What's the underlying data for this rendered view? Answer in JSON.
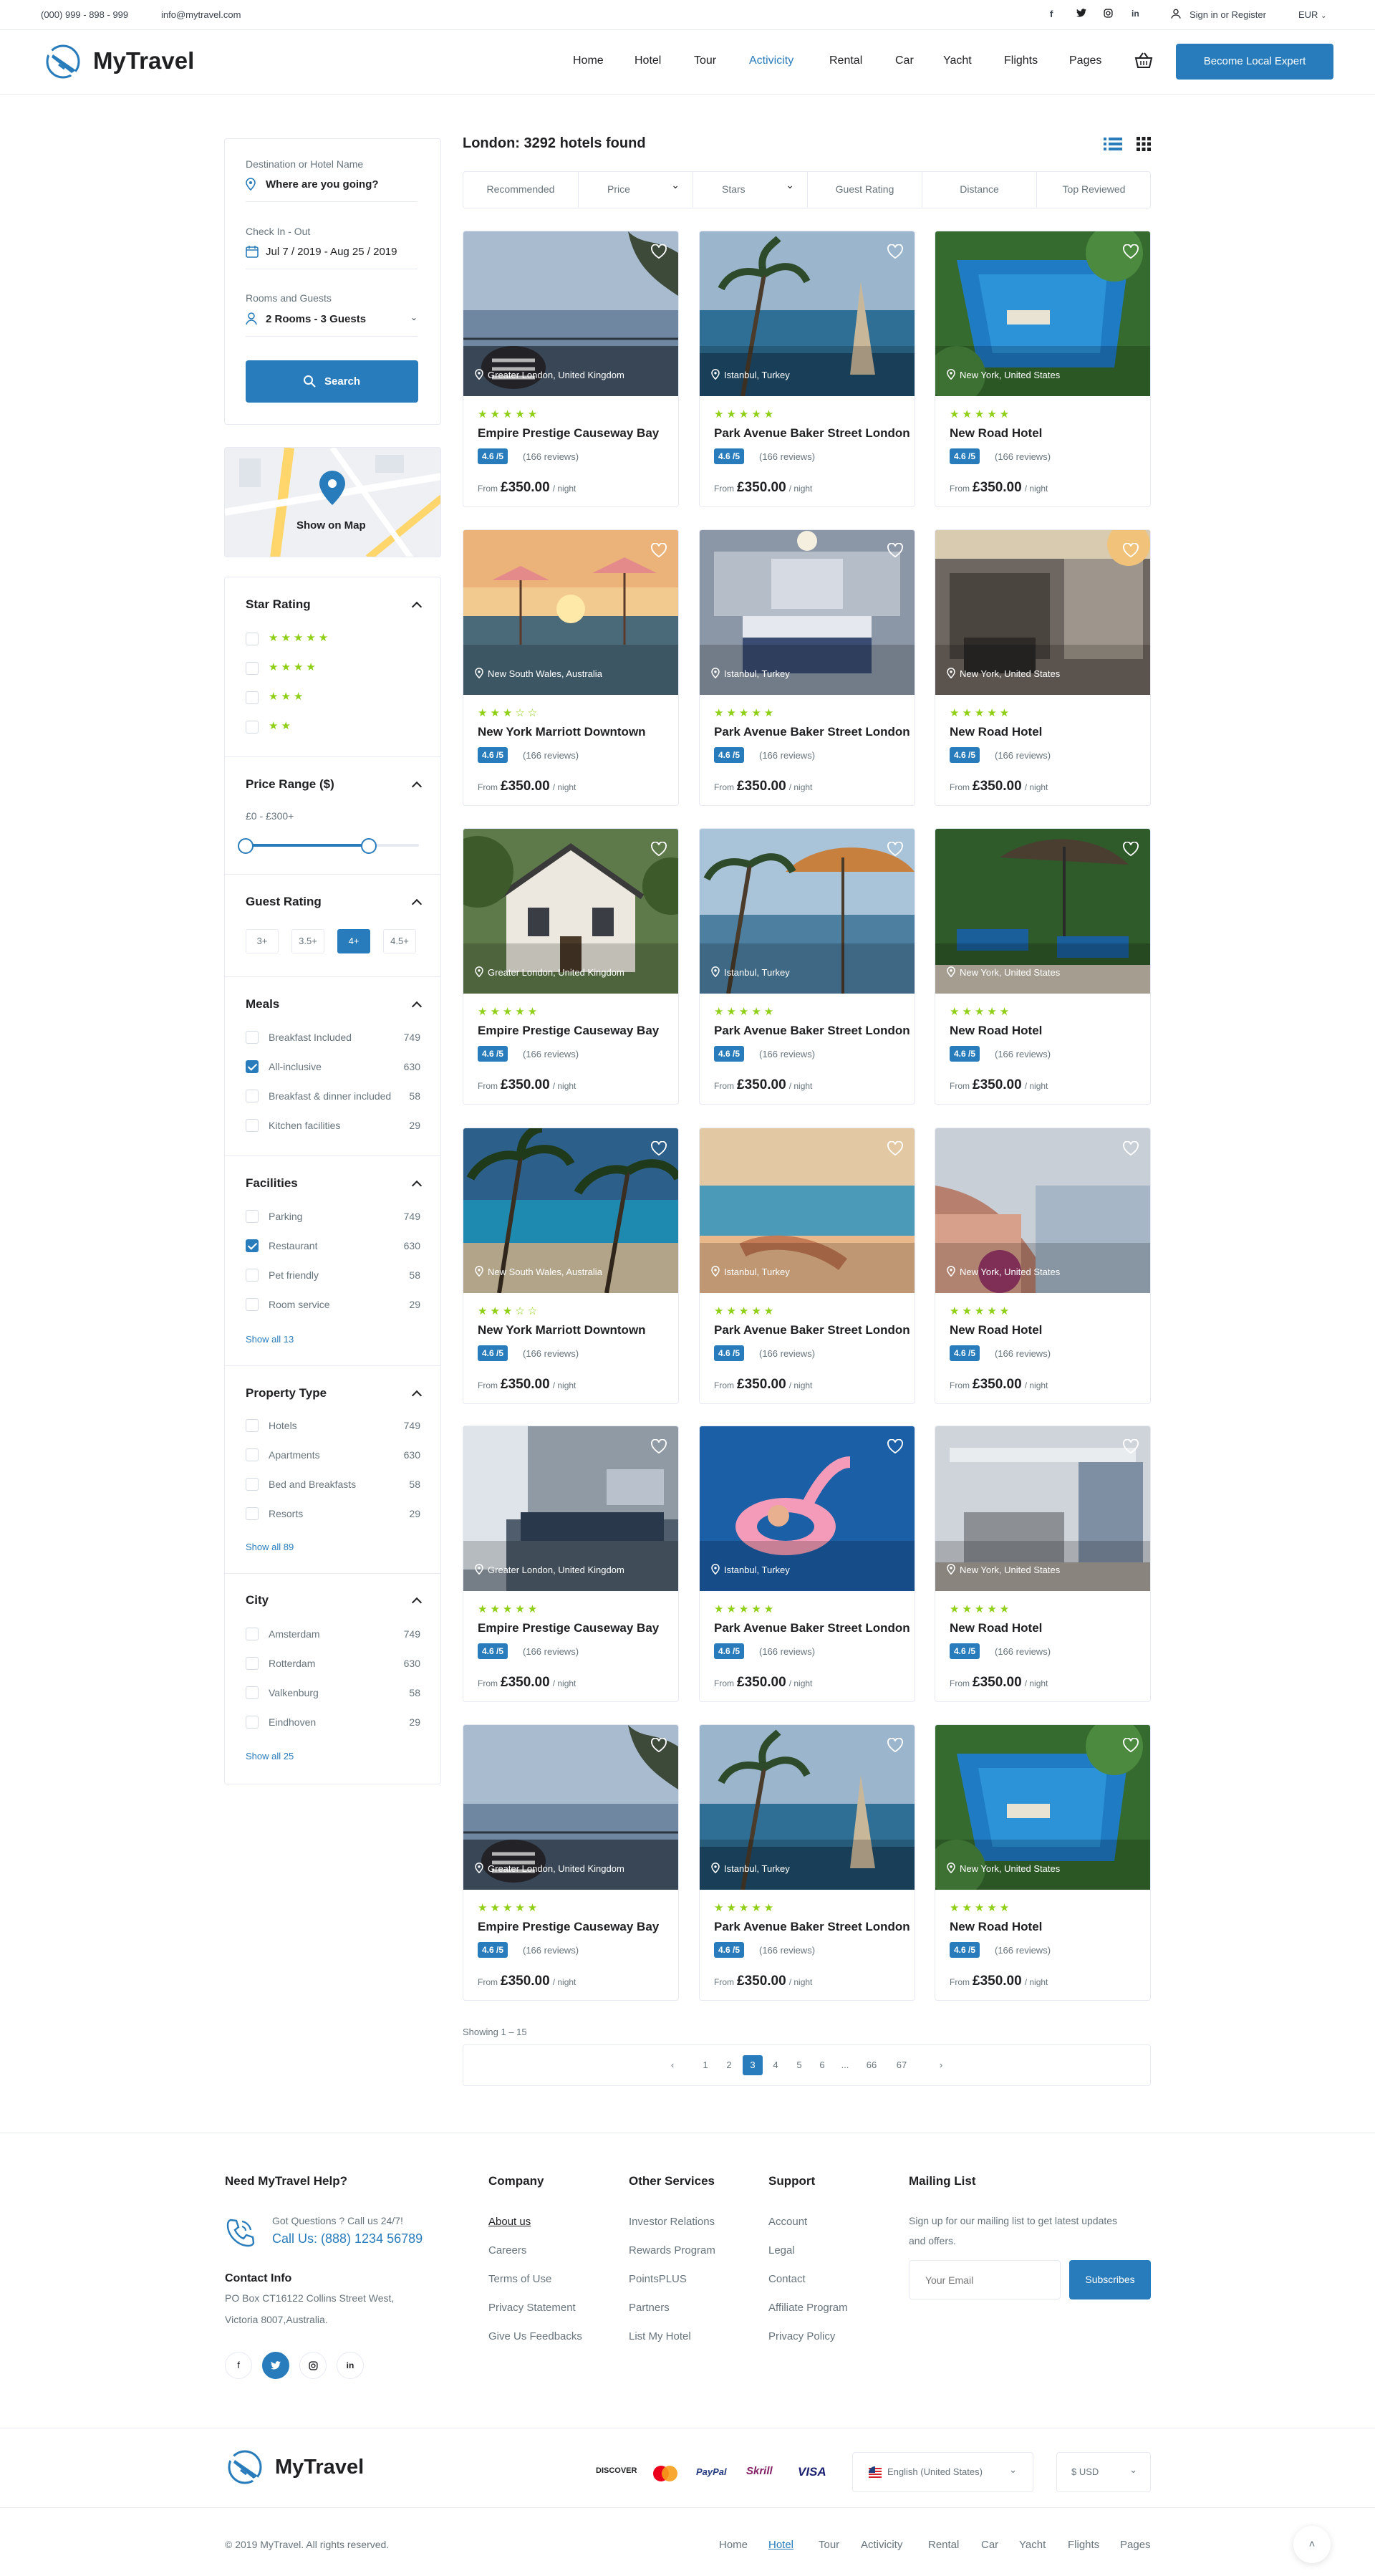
{
  "topbar": {
    "phone": "(000) 999 - 898 - 999",
    "email": "info@mytravel.com",
    "signin": "Sign in or Register",
    "currency": "EUR",
    "social": [
      "f",
      "t",
      "ig",
      "in"
    ]
  },
  "header": {
    "brand": "MyTravel",
    "nav": [
      "Home",
      "Hotel",
      "Tour",
      "Activicity",
      "Rental",
      "Car",
      "Yacht",
      "Flights",
      "Pages"
    ],
    "active_nav": "Activicity",
    "cta": "Become Local Expert"
  },
  "search": {
    "dest_label": "Destination or Hotel Name",
    "dest_value": "Where are you going?",
    "date_label": "Check In - Out",
    "date_value": "Jul 7 / 2019 - Aug 25 / 2019",
    "rooms_label": "Rooms and Guests",
    "rooms_value": "2 Rooms - 3 Guests",
    "button": "Search"
  },
  "map": {
    "label": "Show on Map"
  },
  "filters": {
    "star_title": "Star Rating",
    "star_options": [
      "★★★★★",
      "★★★★",
      "★★★",
      "★★"
    ],
    "price_title": "Price Range ($)",
    "price_value": "£0 - £300+",
    "price_range": [
      0,
      300
    ],
    "price_selected": [
      0,
      300
    ],
    "guest_title": "Guest Rating",
    "guest_options": [
      "3+",
      "3.5+",
      "4+",
      "4.5+"
    ],
    "guest_active": "4+",
    "meals_title": "Meals",
    "meals": [
      {
        "label": "Breakfast Included",
        "count": "749",
        "checked": false
      },
      {
        "label": "All-inclusive",
        "count": "630",
        "checked": true
      },
      {
        "label": "Breakfast & dinner included",
        "count": "58",
        "checked": false
      },
      {
        "label": "Kitchen facilities",
        "count": "29",
        "checked": false
      }
    ],
    "fac_title": "Facilities",
    "facilities": [
      {
        "label": "Parking",
        "count": "749",
        "checked": false
      },
      {
        "label": "Restaurant",
        "count": "630",
        "checked": true
      },
      {
        "label": "Pet friendly",
        "count": "58",
        "checked": false
      },
      {
        "label": "Room service",
        "count": "29",
        "checked": false
      }
    ],
    "fac_showall": "Show all 13",
    "prop_title": "Property Type",
    "property": [
      {
        "label": "Hotels",
        "count": "749"
      },
      {
        "label": "Apartments",
        "count": "630"
      },
      {
        "label": "Bed and Breakfasts",
        "count": "58"
      },
      {
        "label": "Resorts",
        "count": "29"
      }
    ],
    "prop_showall": "Show all 89",
    "city_title": "City",
    "city": [
      {
        "label": "Amsterdam",
        "count": "749"
      },
      {
        "label": "Rotterdam",
        "count": "630"
      },
      {
        "label": "Valkenburg",
        "count": "58"
      },
      {
        "label": "Eindhoven",
        "count": "29"
      }
    ],
    "city_showall": "Show all 25"
  },
  "results": {
    "title": "London: 3292 hotels found",
    "sort": [
      "Recommended",
      "Price",
      "Stars",
      "Guest Rating",
      "Distance",
      "Top Reviewed"
    ],
    "showing": "Showing 1 – 15"
  },
  "hotels": [
    {
      "name": "Empire Prestige Causeway Bay",
      "loc": "Greater London, United Kingdom",
      "stars": 5,
      "rating": "4.6 /5",
      "reviews": "(166 reviews)",
      "from": "From",
      "price": "£350.00",
      "per": "/ night",
      "img": "sea"
    },
    {
      "name": "Park Avenue Baker Street London",
      "loc": "Istanbul, Turkey",
      "stars": 5,
      "rating": "4.6 /5",
      "reviews": "(166 reviews)",
      "from": "From",
      "price": "£350.00",
      "per": "/ night",
      "img": "palm"
    },
    {
      "name": "New Road Hotel",
      "loc": "New York, United States",
      "stars": 5,
      "rating": "4.6 /5",
      "reviews": "(166 reviews)",
      "from": "From",
      "price": "£350.00",
      "per": "/ night",
      "img": "pool"
    },
    {
      "name": "New York Marriott Downtown",
      "loc": "New South Wales, Australia",
      "stars": 3,
      "rating": "4.6 /5",
      "reviews": "(166 reviews)",
      "from": "From",
      "price": "£350.00",
      "per": "/ night",
      "img": "sunset"
    },
    {
      "name": "Park Avenue Baker Street London",
      "loc": "Istanbul, Turkey",
      "stars": 5,
      "rating": "4.6 /5",
      "reviews": "(166 reviews)",
      "from": "From",
      "price": "£350.00",
      "per": "/ night",
      "img": "room"
    },
    {
      "name": "New Road Hotel",
      "loc": "New York, United States",
      "stars": 5,
      "rating": "4.6 /5",
      "reviews": "(166 reviews)",
      "from": "From",
      "price": "£350.00",
      "per": "/ night",
      "img": "lobby"
    },
    {
      "name": "Empire Prestige Causeway Bay",
      "loc": "Greater London, United Kingdom",
      "stars": 5,
      "rating": "4.6 /5",
      "reviews": "(166 reviews)",
      "from": "From",
      "price": "£350.00",
      "per": "/ night",
      "img": "house"
    },
    {
      "name": "Park Avenue Baker Street London",
      "loc": "Istanbul, Turkey",
      "stars": 5,
      "rating": "4.6 /5",
      "reviews": "(166 reviews)",
      "from": "From",
      "price": "£350.00",
      "per": "/ night",
      "img": "umbrella"
    },
    {
      "name": "New Road Hotel",
      "loc": "New York, United States",
      "stars": 5,
      "rating": "4.6 /5",
      "reviews": "(166 reviews)",
      "from": "From",
      "price": "£350.00",
      "per": "/ night",
      "img": "garden"
    },
    {
      "name": "New York Marriott Downtown",
      "loc": "New South Wales, Australia",
      "stars": 3,
      "rating": "4.6 /5",
      "reviews": "(166 reviews)",
      "from": "From",
      "price": "£350.00",
      "per": "/ night",
      "img": "beach"
    },
    {
      "name": "Park Avenue Baker Street London",
      "loc": "Istanbul, Turkey",
      "stars": 5,
      "rating": "4.6 /5",
      "reviews": "(166 reviews)",
      "from": "From",
      "price": "£350.00",
      "per": "/ night",
      "img": "dune"
    },
    {
      "name": "New Road Hotel",
      "loc": "New York, United States",
      "stars": 5,
      "rating": "4.6 /5",
      "reviews": "(166 reviews)",
      "from": "From",
      "price": "£350.00",
      "per": "/ night",
      "img": "coast"
    },
    {
      "name": "Empire Prestige Causeway Bay",
      "loc": "Greater London, United Kingdom",
      "stars": 5,
      "rating": "4.6 /5",
      "reviews": "(166 reviews)",
      "from": "From",
      "price": "£350.00",
      "per": "/ night",
      "img": "bed"
    },
    {
      "name": "Park Avenue Baker Street London",
      "loc": "Istanbul, Turkey",
      "stars": 5,
      "rating": "4.6 /5",
      "reviews": "(166 reviews)",
      "from": "From",
      "price": "£350.00",
      "per": "/ night",
      "img": "flamingo"
    },
    {
      "name": "New Road Hotel",
      "loc": "New York, United States",
      "stars": 5,
      "rating": "4.6 /5",
      "reviews": "(166 reviews)",
      "from": "From",
      "price": "£350.00",
      "per": "/ night",
      "img": "suite"
    },
    {
      "name": "Empire Prestige Causeway Bay",
      "loc": "Greater London, United Kingdom",
      "stars": 5,
      "rating": "4.6 /5",
      "reviews": "(166 reviews)",
      "from": "From",
      "price": "£350.00",
      "per": "/ night",
      "img": "sea"
    },
    {
      "name": "Park Avenue Baker Street London",
      "loc": "Istanbul, Turkey",
      "stars": 5,
      "rating": "4.6 /5",
      "reviews": "(166 reviews)",
      "from": "From",
      "price": "£350.00",
      "per": "/ night",
      "img": "palm"
    },
    {
      "name": "New Road Hotel",
      "loc": "New York, United States",
      "stars": 5,
      "rating": "4.6 /5",
      "reviews": "(166 reviews)",
      "from": "From",
      "price": "£350.00",
      "per": "/ night",
      "img": "pool"
    }
  ],
  "pagination": [
    "1",
    "2",
    "3",
    "4",
    "5",
    "6",
    "...",
    "66",
    "67"
  ],
  "page_active": "3",
  "footer": {
    "help_title": "Need MyTravel Help?",
    "help_q": "Got Questions ? Call us 24/7!",
    "help_call": "Call Us: (888) 1234 56789",
    "contact_title": "Contact Info",
    "contact_addr1": "PO Box CT16122 Collins Street West,",
    "contact_addr2": "Victoria 8007,Australia.",
    "social": [
      "f",
      "t",
      "ig",
      "in"
    ],
    "company": {
      "title": "Company",
      "links": [
        "About us",
        "Careers",
        "Terms of Use",
        "Privacy Statement",
        "Give Us Feedbacks"
      ]
    },
    "services": {
      "title": "Other Services",
      "links": [
        "Investor Relations",
        "Rewards Program",
        "PointsPLUS",
        "Partners",
        "List My Hotel"
      ]
    },
    "support": {
      "title": "Support",
      "links": [
        "Account",
        "Legal",
        "Contact",
        "Affiliate Program",
        "Privacy Policy"
      ]
    },
    "mail": {
      "title": "Mailing List",
      "text1": "Sign up for our mailing list to get latest updates",
      "text2": "and offers.",
      "placeholder": "Your Email",
      "button": "Subscribes"
    },
    "payments": [
      "DISCOVER",
      "mastercard",
      "PayPal",
      "Skrill",
      "VISA"
    ],
    "lang": "English (United States)",
    "currency": "$ USD",
    "copyright": "© 2019 MyTravel. All rights reserved.",
    "bottom_nav": [
      "Home",
      "Hotel",
      "Tour",
      "Activicity",
      "Rental",
      "Car",
      "Yacht",
      "Flights",
      "Pages"
    ]
  },
  "colors": {
    "primary": "#297cbb",
    "star": "#8fcf15",
    "text": "#1e2022",
    "muted": "#67747c"
  }
}
